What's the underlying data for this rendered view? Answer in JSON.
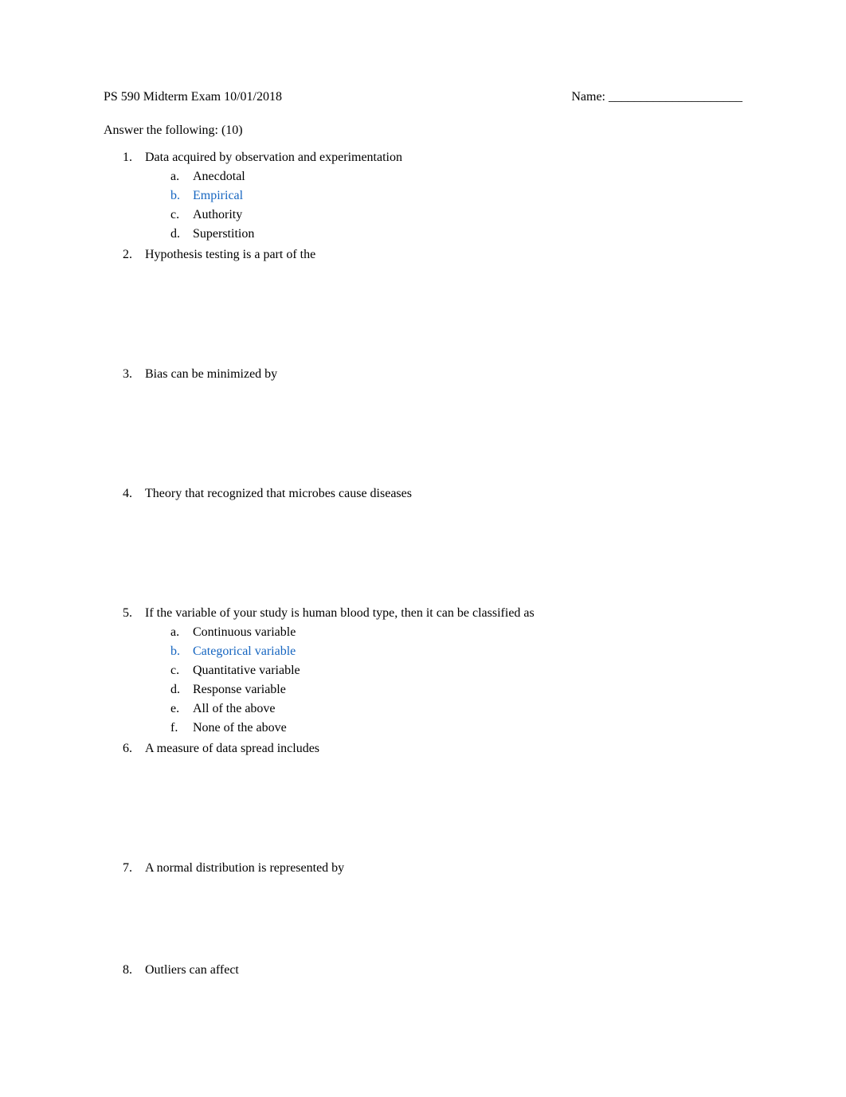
{
  "header": {
    "exam_title": "PS 590 Midterm Exam",
    "exam_date": "10/01/2018",
    "name_label": "Name: _____________________"
  },
  "instruction": "Answer the following: (10)",
  "questions": [
    {
      "number": "1.",
      "text": "Data acquired by observation and experimentation",
      "options": [
        {
          "label": "a.",
          "text": "Anecdotal",
          "highlighted": false
        },
        {
          "label": "b.",
          "text": "Empirical",
          "highlighted": true
        },
        {
          "label": "c.",
          "text": "Authority",
          "highlighted": false
        },
        {
          "label": "d.",
          "text": "Superstition",
          "highlighted": false
        }
      ]
    },
    {
      "number": "2.",
      "text": "Hypothesis testing is a part of the"
    },
    {
      "number": "3.",
      "text": "Bias can be minimized by"
    },
    {
      "number": "4.",
      "text": "Theory that recognized that microbes cause diseases"
    },
    {
      "number": "5.",
      "text": "If the variable of your study is human blood type, then it can be classified as",
      "options": [
        {
          "label": "a.",
          "text": "Continuous variable",
          "highlighted": false
        },
        {
          "label": "b.",
          "text": "Categorical variable",
          "highlighted": true
        },
        {
          "label": "c.",
          "text": "Quantitative variable",
          "highlighted": false
        },
        {
          "label": "d.",
          "text": "Response variable",
          "highlighted": false
        },
        {
          "label": "e.",
          "text": "All of the above",
          "highlighted": false
        },
        {
          "label": "f.",
          "text": "None of the above",
          "highlighted": false
        }
      ]
    },
    {
      "number": "6.",
      "text": "A measure of data spread includes"
    },
    {
      "number": "7.",
      "text": "A normal distribution is represented by"
    },
    {
      "number": "8.",
      "text": "Outliers can affect"
    }
  ]
}
